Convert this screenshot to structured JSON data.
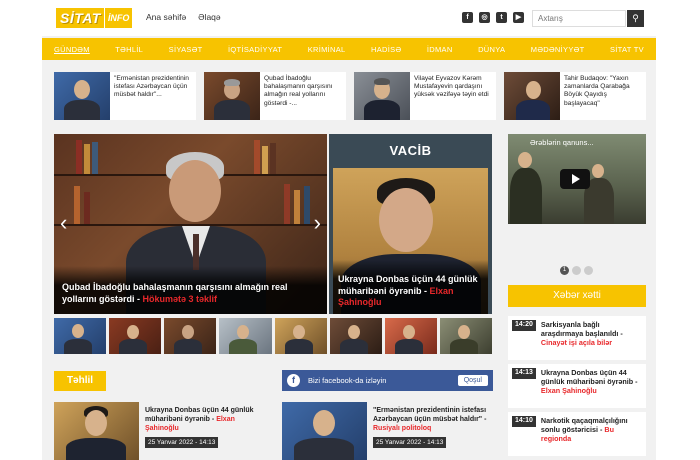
{
  "header": {
    "logo_main": "SİTAT",
    "logo_sub": "İNFO",
    "links": [
      "Ana səhifə",
      "Əlaqə"
    ],
    "search_placeholder": "Axtarış",
    "social_icons": [
      "facebook-icon",
      "instagram-icon",
      "twitter-icon",
      "youtube-icon"
    ]
  },
  "nav": {
    "items": [
      "GÜNDƏM",
      "TƏHLİL",
      "SİYASƏT",
      "İQTİSADİYYAT",
      "KRİMİNAL",
      "HADİSƏ",
      "İDMAN",
      "DÜNYA",
      "MƏDƏNİYYƏT",
      "SİTAT TV"
    ],
    "active_index": 0
  },
  "strip": [
    {
      "text": "\"Ermənistan prezidentinin istefası Azərbaycan üçün müsbət haldır\"..."
    },
    {
      "text": "Qubad İbadoğlu bahalaşmanın qarşısını almağın real yollarını göstərdi -..."
    },
    {
      "text": "Vilayət Eyvazov Kərəm Mustafayevin qardaşını yüksək vəzifəyə təyin etdi"
    },
    {
      "text": "Tahir Budaqov: \"Yaxın zamanlarda Qarabağa Böyük Qayıdış başlayacaq\""
    }
  ],
  "slider": {
    "caption": "Qubad İbadoğlu bahalaşmanın qarşısını almağın real yollarını göstərdi -",
    "caption_red": "Hökumətə 3 təklif"
  },
  "vacib": {
    "title": "VACİB",
    "caption": "Ukrayna Donbas üçün 44 günlük müharibəni öyrənib -",
    "caption_red": "Elxan Şahinoğlu"
  },
  "video": {
    "title": "Ərəblərin qanuns..."
  },
  "dots": [
    "1",
    "",
    ""
  ],
  "xeber": {
    "title": "Xəbər xətti",
    "items": [
      {
        "time": "14:20",
        "text": "Sarkisyanla bağlı araşdırmaya başlanıldı -",
        "red": "Cinayət işi açıla bilər"
      },
      {
        "time": "14:13",
        "text": "Ukrayna Donbas üçün 44 günlük müharibəni öyrənib -",
        "red": "Elxan Şahinoğlu"
      },
      {
        "time": "14:10",
        "text": "Narkotik qaçaqmalçılığını sonlu göstəricisi -",
        "red": "Bu regionda"
      }
    ]
  },
  "tehlil": {
    "title": "Təhlil"
  },
  "facebook": {
    "icon": "f",
    "text": "Bizi facebook-da izləyin",
    "button": "Qoşul"
  },
  "cards": [
    {
      "text": "Ukrayna Donbas üçün 44 günlük müharibəni öyrənib -",
      "red": "Elxan Şahinoğlu",
      "date": "25 Yanvar 2022 - 14:13"
    },
    {
      "text": "\"Ermənistan prezidentinin istefası Azərbaycan üçün müsbət haldır\" -",
      "red": "Rusiyalı politoloq",
      "date": "25 Yanvar 2022 - 14:13"
    }
  ],
  "colors": {
    "accent": "#f7c300",
    "red": "#e8282b",
    "dark": "#333333",
    "facebook": "#3b5998"
  }
}
